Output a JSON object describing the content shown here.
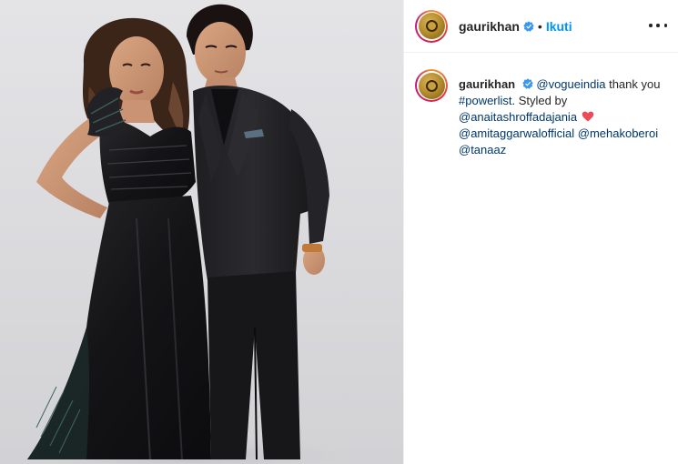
{
  "post": {
    "username": "gaurikhan",
    "follow_label": "Ikuti",
    "separator": "•",
    "more_label": "More options"
  },
  "caption": {
    "username": "gaurikhan",
    "mention_vogue": "@vogueindia",
    "text_thank": " thank you",
    "hashtag": "#powerlist",
    "text_styled": ". Styled by",
    "mention_anaita": "@anaitashroffadajania",
    "mention_amit": "@amitaggarwalofficial",
    "mention_mehak": "@mehakoberoi",
    "mention_tanaaz": "@tanaaz"
  },
  "colors": {
    "link": "#00376b",
    "follow": "#0095f6",
    "verified": "#3897f0",
    "heart": "#ed4956"
  },
  "icons": {
    "verified": "verified-badge-icon",
    "heart": "heart-emoji-icon",
    "more": "more-options-icon"
  }
}
